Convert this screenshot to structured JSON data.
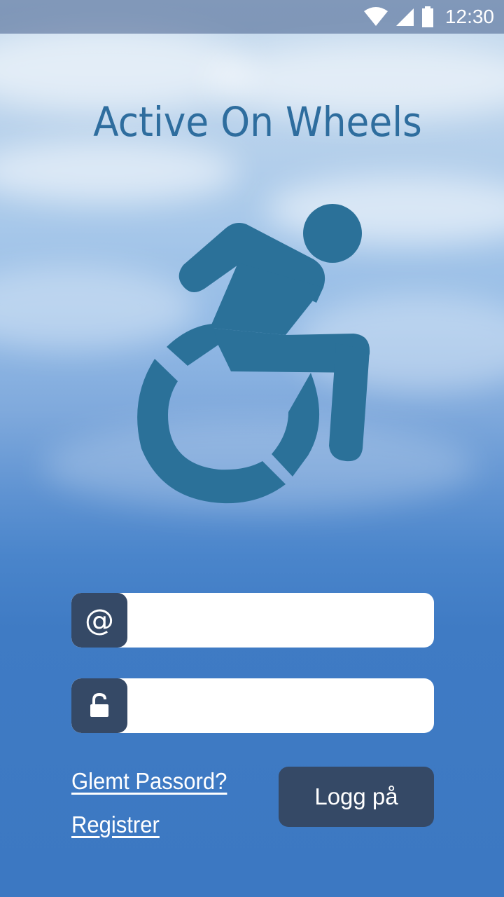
{
  "status_bar": {
    "time": "12:30",
    "icons": [
      "wifi-icon",
      "signal-icon",
      "battery-icon"
    ]
  },
  "app": {
    "title": "Active On Wheels",
    "logo_icon": "wheelchair-icon"
  },
  "login_form": {
    "email_field": {
      "icon_glyph": "@",
      "value": "",
      "placeholder": ""
    },
    "password_field": {
      "icon": "unlock-icon",
      "value": "",
      "placeholder": ""
    },
    "forgot_password_label": "Glemt Passord?",
    "register_label": "Registrer",
    "login_button_label": "Logg på"
  },
  "colors": {
    "title": "#2e6d9e",
    "logo": "#2b7199",
    "button_bg": "#354966",
    "background_bottom": "#3c78c2"
  }
}
